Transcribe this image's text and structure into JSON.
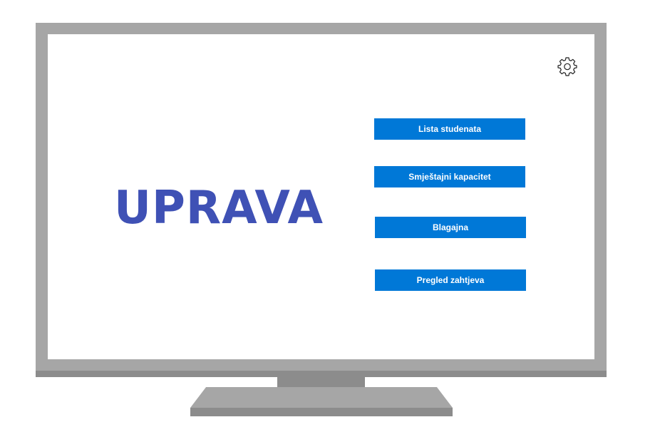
{
  "screen": {
    "title": "UPRAVA",
    "menu": [
      {
        "label": "Lista studenata"
      },
      {
        "label": "Smještajni kapacitet"
      },
      {
        "label": "Blagajna"
      },
      {
        "label": "Pregled zahtjeva"
      }
    ],
    "settings_icon": "gear-icon"
  },
  "colors": {
    "title": "#3f51b5",
    "button_bg": "#0078d7",
    "button_text": "#ffffff",
    "frame": "#a6a6a6",
    "frame_dark": "#8c8c8c"
  }
}
